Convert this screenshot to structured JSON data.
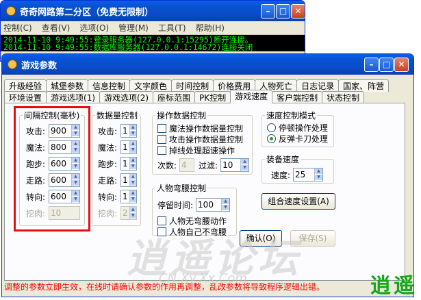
{
  "back_window": {
    "title": "奇奇网路第二分区（免费无限制）",
    "menu": [
      "控制(C)",
      "查看(V)",
      "选项(O)",
      "管理(M)",
      "工具(T)",
      "帮助(H)"
    ],
    "log": [
      "2014-11-10 9:49:55:登录服务器(127.0.0.1:15295)断开连接。",
      "2014-11-10 9:49:55:数据库服务器(127.0.0.1:14672)连接关闭"
    ]
  },
  "dialog": {
    "title": "游戏参数",
    "tabs_row1": [
      "升级经验",
      "城堡参数",
      "信息控制",
      "文字颜色",
      "时间控制",
      "价格费用",
      "人物死亡",
      "日志记录",
      "国家、阵营"
    ],
    "tabs_row2": [
      "环境设置",
      "游戏选项(1)",
      "游戏选项(2)",
      "座标范围",
      "PK控制",
      "游戏速度",
      "客户端控制",
      "状态控制"
    ],
    "active_tab": "游戏速度",
    "interval": {
      "title": "间隔控制(毫秒)",
      "rows": [
        {
          "label": "攻击:",
          "value": "900"
        },
        {
          "label": "魔法:",
          "value": "800"
        },
        {
          "label": "跑步:",
          "value": "600"
        },
        {
          "label": "走路:",
          "value": "600"
        },
        {
          "label": "转向:",
          "value": "600"
        },
        {
          "label": "挖肉:",
          "value": "10"
        }
      ]
    },
    "count": {
      "title": "数据量控制",
      "rows": [
        {
          "label": "攻击:",
          "value": "1"
        },
        {
          "label": "魔法:",
          "value": "1"
        },
        {
          "label": "跑步:",
          "value": "1"
        },
        {
          "label": "走路:",
          "value": "1"
        },
        {
          "label": "转向:",
          "value": "1"
        },
        {
          "label": "挖肉:",
          "value": "2"
        }
      ]
    },
    "operation": {
      "title": "操作数据控制",
      "checks": [
        "魔法操作数据量控制",
        "攻击操作数据量控制",
        "掉线处理超速操作"
      ],
      "times_label": "次数:",
      "times_value": "4",
      "filter_label": "过滤:",
      "filter_value": "10"
    },
    "bend": {
      "title": "人物弯腰控制",
      "stay_label": "停留时间:",
      "stay_value": "100",
      "checks": [
        "人物无弯腰动作",
        "人物自己不弯腰"
      ]
    },
    "speed_mode": {
      "title": "速度控制模式",
      "options": [
        "停顿操作处理",
        "反弹卡刀处理"
      ],
      "selected": 1
    },
    "equip_speed": {
      "title": "装备速度",
      "speed_label": "速度:",
      "speed_value": "25"
    },
    "combo_button": "组合速度设置(A)",
    "ok_button": "确认(O)",
    "save_button": "保存(S)",
    "status_text": "调整的参数立即生效，在线时请确认参数的作用再调整，乱改参数将导致程序逻辑出错。",
    "watermark": "逍遥论坛",
    "watermark_sub": "CN.Xy.Xx.Com",
    "brand": "逍遥"
  }
}
